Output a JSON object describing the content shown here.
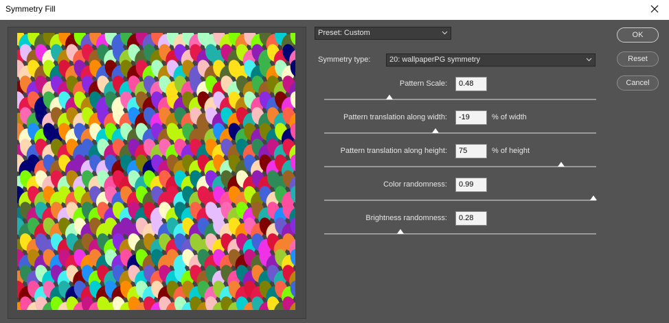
{
  "window": {
    "title": "Symmetry Fill"
  },
  "preset": {
    "label": "Preset: Custom"
  },
  "symmetry": {
    "label": "Symmetry type:",
    "value": "20: wallpaperPG symmetry"
  },
  "params": [
    {
      "label": "Pattern Scale:",
      "value": "0.48",
      "unit": "",
      "slider": 0.24
    },
    {
      "label": "Pattern translation along width:",
      "value": "-19",
      "unit": "% of width",
      "slider": 0.41
    },
    {
      "label": "Pattern translation along height:",
      "value": "75",
      "unit": "% of height",
      "slider": 0.87
    },
    {
      "label": "Color randomness:",
      "value": "0.99",
      "unit": "",
      "slider": 0.99
    },
    {
      "label": "Brightness randomness:",
      "value": "0.28",
      "unit": "",
      "slider": 0.28
    }
  ],
  "buttons": {
    "ok": "OK",
    "reset": "Reset",
    "cancel": "Cancel"
  },
  "icons": {
    "close": "close-icon",
    "dropdown": "chevron-down-icon"
  }
}
